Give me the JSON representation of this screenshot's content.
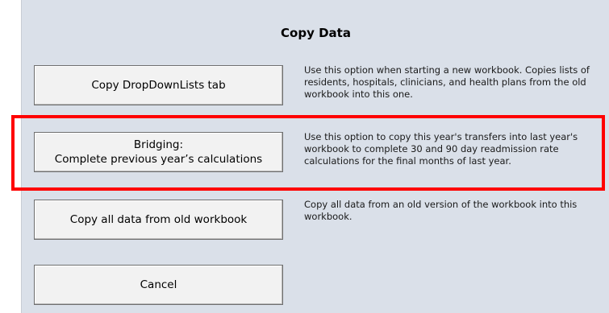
{
  "dialog": {
    "title": "Copy Data"
  },
  "options": {
    "dropdown": {
      "button_label": "Copy DropDownLists tab",
      "description": "Use this option when starting a new workbook. Copies lists of residents, hospitals, clinicians, and health plans from the old workbook into this one."
    },
    "bridging": {
      "button_line1": "Bridging:",
      "button_line2": "Complete previous year’s calculations",
      "description": "Use this option to copy this year's transfers into last year's workbook to complete 30 and 90 day readmission rate calculations for the final months of last year."
    },
    "copy_all": {
      "button_label": "Copy all data from old workbook",
      "description": "Copy all data from an old version of the workbook into this workbook."
    },
    "cancel": {
      "button_label": "Cancel"
    }
  },
  "highlight": {
    "color": "#ff0000"
  }
}
